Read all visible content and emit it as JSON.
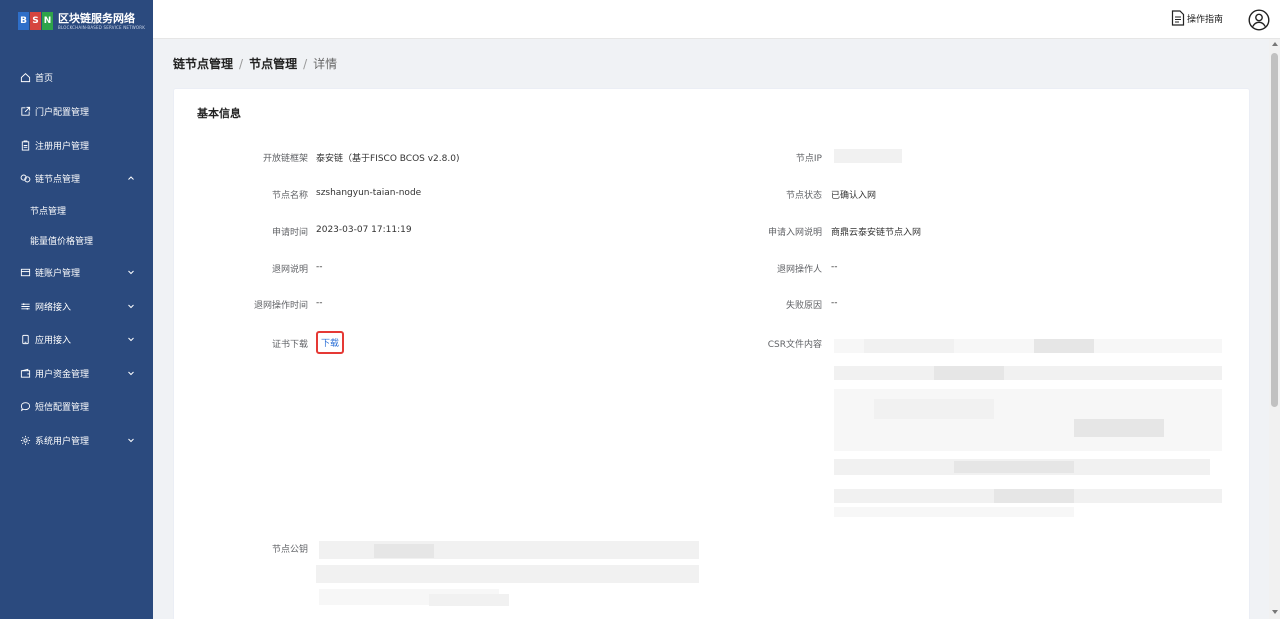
{
  "brand": {
    "tiles": [
      "B",
      "S",
      "N"
    ],
    "tile_colors": [
      "#2e6fc9",
      "#d6453f",
      "#2fa34a"
    ],
    "title": "区块链服务网络",
    "subtitle": "BLOCKCHAIN-BASED SERVICE NETWORK"
  },
  "sidebar": {
    "items": [
      {
        "label": "首页",
        "icon": "home-icon"
      },
      {
        "label": "门户配置管理",
        "icon": "external-link-icon"
      },
      {
        "label": "注册用户管理",
        "icon": "clipboard-icon"
      },
      {
        "label": "链节点管理",
        "icon": "nodes-icon",
        "expanded": true
      },
      {
        "label": "节点管理",
        "sub": true
      },
      {
        "label": "能量值价格管理",
        "sub": true
      },
      {
        "label": "链账户管理",
        "icon": "card-icon"
      },
      {
        "label": "网络接入",
        "icon": "sliders-icon"
      },
      {
        "label": "应用接入",
        "icon": "phone-icon"
      },
      {
        "label": "用户资金管理",
        "icon": "wallet-icon"
      },
      {
        "label": "短信配置管理",
        "icon": "message-icon"
      },
      {
        "label": "系统用户管理",
        "icon": "gear-icon"
      }
    ]
  },
  "topbar": {
    "guide_label": "操作指南"
  },
  "breadcrumb": [
    "链节点管理",
    "节点管理",
    "详情"
  ],
  "card": {
    "title": "基本信息",
    "fields": {
      "framework": {
        "label": "开放链框架",
        "value": "泰安链（基于FISCO BCOS v2.8.0)"
      },
      "node_ip": {
        "label": "节点IP",
        "value": ""
      },
      "node_name": {
        "label": "节点名称",
        "value": "szshangyun-taian-node"
      },
      "node_status": {
        "label": "节点状态",
        "value": "已确认入网"
      },
      "apply_time": {
        "label": "申请时间",
        "value": "2023-03-07 17:11:19"
      },
      "apply_desc": {
        "label": "申请入网说明",
        "value": "商鼎云泰安链节点入网"
      },
      "exit_desc": {
        "label": "退网说明",
        "value": "--"
      },
      "exit_operator": {
        "label": "退网操作人",
        "value": "--"
      },
      "exit_time": {
        "label": "退网操作时间",
        "value": "--"
      },
      "fail_reason": {
        "label": "失败原因",
        "value": "--"
      },
      "cert_download": {
        "label": "证书下载",
        "button": "下载"
      },
      "csr_content": {
        "label": "CSR文件内容"
      },
      "node_pubkey": {
        "label": "节点公钥"
      }
    }
  }
}
